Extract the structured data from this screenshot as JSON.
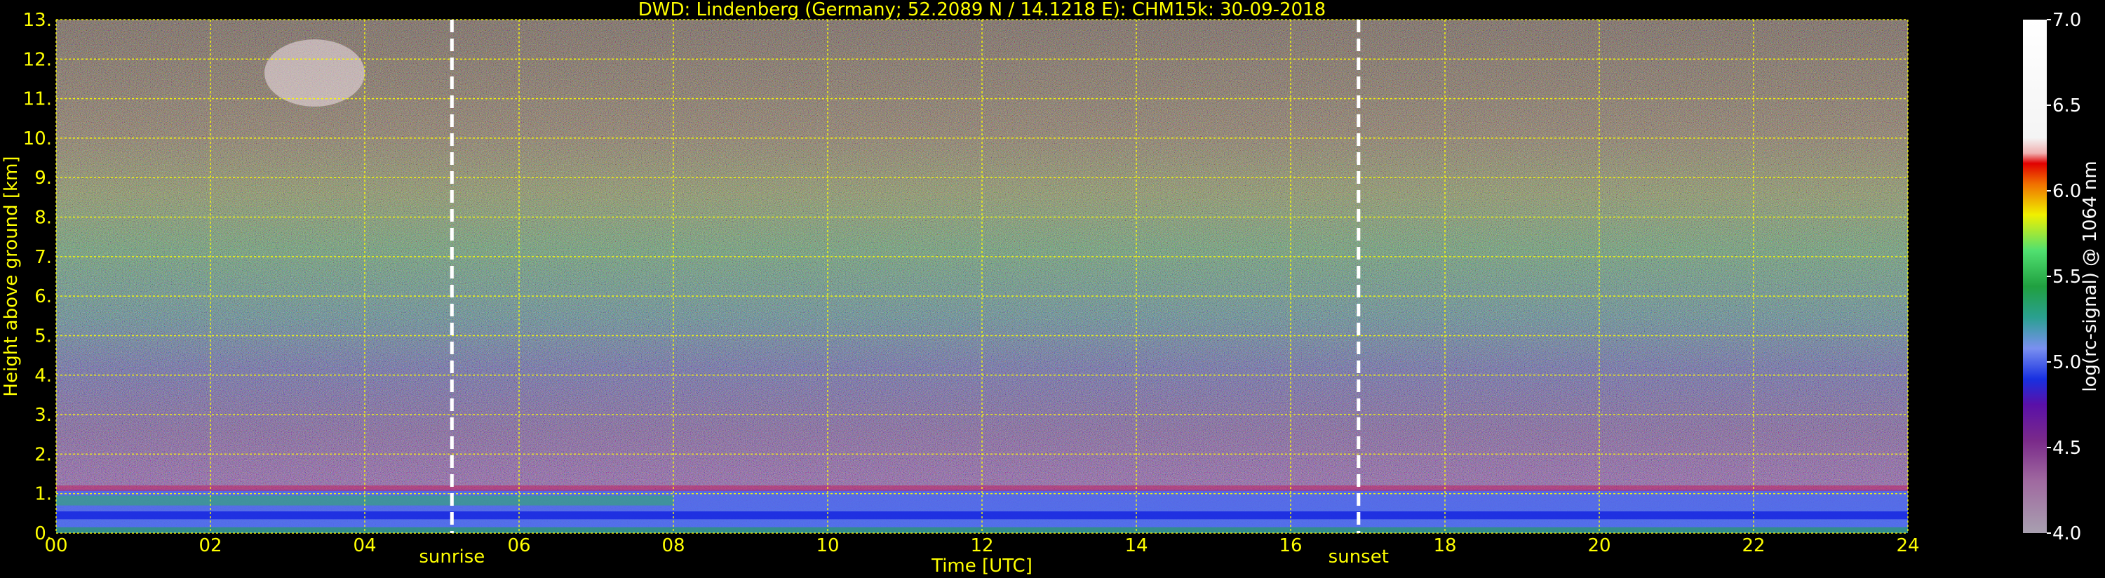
{
  "chart_data": {
    "type": "heatmap",
    "title": "DWD: Lindenberg (Germany; 52.2089 N / 14.1218 E):    CHM15k: 30-09-2018",
    "xlabel": "Time [UTC]",
    "ylabel": "Height above ground [km]",
    "xlim": [
      0,
      24
    ],
    "ylim": [
      0,
      13
    ],
    "x_ticks": [
      0,
      2,
      4,
      6,
      8,
      10,
      12,
      14,
      16,
      18,
      20,
      22,
      24
    ],
    "x_tick_labels": [
      "00",
      "02",
      "04",
      "06",
      "08",
      "10",
      "12",
      "14",
      "16",
      "18",
      "20",
      "22",
      "24"
    ],
    "y_ticks": [
      0,
      1,
      2,
      3,
      4,
      5,
      6,
      7,
      8,
      9,
      10,
      11,
      12,
      13
    ],
    "y_tick_labels": [
      "0.",
      "1.",
      "2.",
      "3.",
      "4.",
      "5.",
      "6.",
      "7.",
      "8.",
      "9.",
      "10.",
      "11.",
      "12.",
      "13."
    ],
    "grid": true,
    "events": [
      {
        "label": "sunrise",
        "time": 5.13
      },
      {
        "label": "sunset",
        "time": 16.88
      }
    ],
    "colorbar": {
      "label": "log(rc-signal) @ 1064 nm",
      "min": 4.0,
      "max": 7.0,
      "ticks": [
        4.0,
        4.5,
        5.0,
        5.5,
        6.0,
        6.5,
        7.0
      ],
      "tick_labels": [
        "4.0",
        "4.5",
        "5.0",
        "5.5",
        "6.0",
        "6.5",
        "7.0"
      ]
    },
    "features": {
      "boundary_layer_top_km": 1.1,
      "upper_cloud": {
        "time_start": 2.7,
        "time_end": 4.0,
        "height_bottom_km": 10.8,
        "height_top_km": 12.5
      }
    }
  },
  "colors": {
    "background": "#000000",
    "axis_text": "#ffff00",
    "grid": "#ffff00",
    "colorbar_text": "#ffffff",
    "event_line": "#ffffff"
  }
}
